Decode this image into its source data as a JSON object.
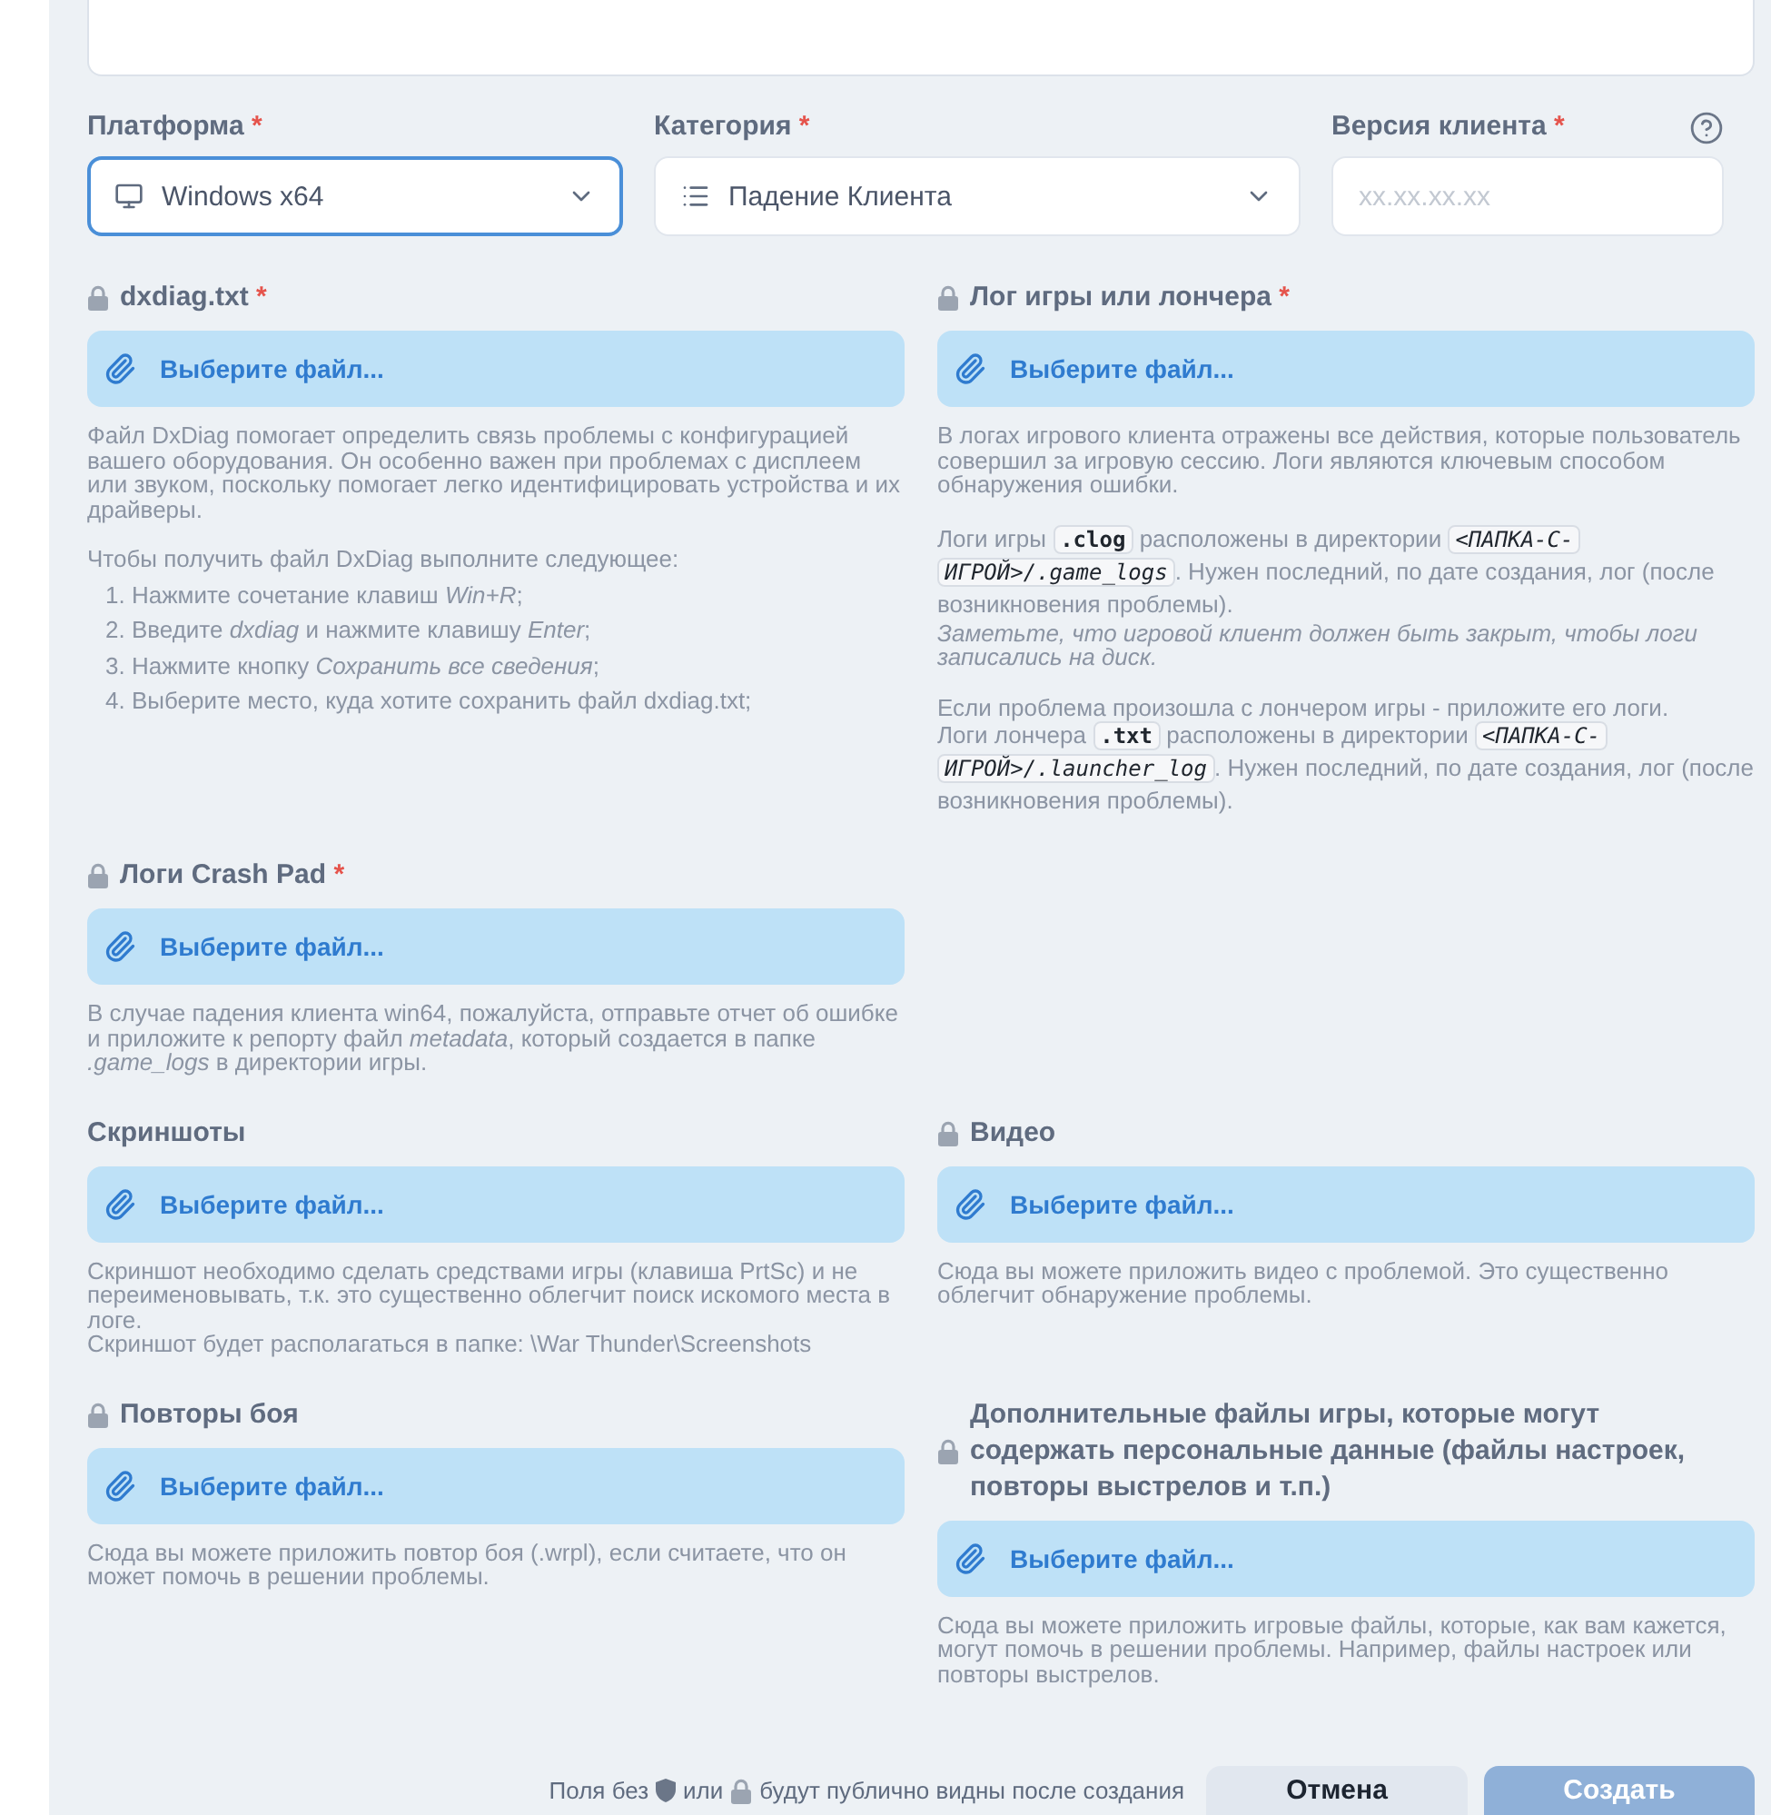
{
  "fields": [
    {
      "kind": "platform",
      "label": "Платформа",
      "required_mark": "*",
      "value": "Windows x64",
      "focused": true,
      "help": false
    },
    {
      "kind": "category",
      "label": "Категория",
      "required_mark": "*",
      "value": "Падение Клиента",
      "focused": false,
      "help": false
    },
    {
      "kind": "version",
      "label": "Версия клиента",
      "required_mark": "*",
      "placeholder": "xx.xx.xx.xx",
      "focused": false,
      "help": true
    }
  ],
  "rows": [
    {
      "items": [
        {
          "label": "dxdiag.txt",
          "required_mark": "*",
          "locked": true,
          "button": "Выберите файл...",
          "blocks": [
            {
              "paragraphs": [
                {
                  "kind": "text",
                  "text": "Файл DxDiag помогает определить связь проблемы с конфигурацией вашего оборудования. Он особенно важен при проблемах с дисплеем или звуком, поскольку помогает легко идентифицировать устройства и их драйверы."
                }
              ]
            },
            {
              "paragraphs": [
                {
                  "kind": "text",
                  "text": "Чтобы получить файл DxDiag выполните следующее:"
                },
                {
                  "kind": "step",
                  "text": "1. Нажмите сочетание клавиш *Win+R*;"
                },
                {
                  "kind": "step",
                  "text": "2. Введите *dxdiag* и нажмите клавишу *Enter*;"
                },
                {
                  "kind": "step",
                  "text": "3. Нажмите кнопку *Сохранить все сведения*;"
                },
                {
                  "kind": "step",
                  "text": "4. Выберите место, куда хотите сохранить файл dxdiag.txt;"
                }
              ]
            }
          ]
        },
        {
          "label": "Лог игры или лончера",
          "required_mark": "*",
          "locked": true,
          "button": "Выберите файл...",
          "blocks": [
            {
              "paragraphs": [
                {
                  "kind": "text",
                  "text": "В логах игрового клиента отражены все действия, которые пользователь совершил за игровую сессию. Логи являются ключевым способом обнаружения ошибки."
                }
              ]
            },
            {
              "paragraphs": [
                {
                  "kind": "mixed",
                  "parts": [
                    {
                      "kind": "text",
                      "text": "Логи игры "
                    },
                    {
                      "kind": "code",
                      "text": ".clog"
                    },
                    {
                      "kind": "text",
                      "text": " расположены в директории "
                    },
                    {
                      "kind": "path",
                      "text": "<ПАПКА-С-ИГРОЙ>/.game_logs"
                    },
                    {
                      "kind": "text",
                      "text": ". Нужен последний, по дате создания, лог (после возникновения проблемы)."
                    }
                  ]
                },
                {
                  "kind": "note",
                  "text": "Заметьте, что игровой клиент должен быть закрыт, чтобы логи записались на диск."
                }
              ]
            },
            {
              "paragraphs": [
                {
                  "kind": "text",
                  "text": "Если проблема произошла с лончером игры - приложите его логи."
                },
                {
                  "kind": "mixed",
                  "parts": [
                    {
                      "kind": "text",
                      "text": "Логи лончера "
                    },
                    {
                      "kind": "code",
                      "text": ".txt"
                    },
                    {
                      "kind": "text",
                      "text": " расположены в директории "
                    },
                    {
                      "kind": "path",
                      "text": "<ПАПКА-С-ИГРОЙ>/.launcher_log"
                    },
                    {
                      "kind": "text",
                      "text": ". Нужен последний, по дате создания, лог (после возникновения проблемы)."
                    }
                  ]
                }
              ]
            }
          ]
        }
      ]
    },
    {
      "items": [
        {
          "label": "Логи Crash Pad",
          "required_mark": "*",
          "locked": true,
          "button": "Выберите файл...",
          "blocks": [
            {
              "paragraphs": [
                {
                  "kind": "text",
                  "text": "В случае падения клиента win64, пожалуйста, отправьте отчет об ошибке и приложите к репорту файл *metadata*, который создается в папке *.game_logs* в директории игры."
                }
              ]
            }
          ]
        }
      ]
    },
    {
      "items": [
        {
          "label": "Скриншоты",
          "locked": false,
          "button": "Выберите файл...",
          "blocks": [
            {
              "paragraphs": [
                {
                  "kind": "text",
                  "text": "Скриншот необходимо сделать средствами игры (клавиша PrtSc) и не переименовывать, т.к. это существенно облегчит поиск искомого места в логе."
                },
                {
                  "kind": "text",
                  "text": "Скриншот будет располагаться в папке: \\War Thunder\\Screenshots"
                }
              ]
            }
          ]
        },
        {
          "label": "Видео",
          "locked": true,
          "button": "Выберите файл...",
          "blocks": [
            {
              "paragraphs": [
                {
                  "kind": "text",
                  "text": "Сюда вы можете приложить видео с проблемой. Это существенно облегчит обнаружение проблемы."
                }
              ]
            }
          ]
        }
      ]
    },
    {
      "items": [
        {
          "label": "Повторы боя",
          "locked": true,
          "button": "Выберите файл...",
          "blocks": [
            {
              "paragraphs": [
                {
                  "kind": "text",
                  "text": "Сюда вы можете приложить повтор боя (.wrpl), если считаете, что он может помочь в решении проблемы."
                }
              ]
            }
          ]
        },
        {
          "label": "Дополнительные файлы игры, которые могут содержать персональные данные (файлы настроек, повторы выстрелов и т.п.)",
          "locked": true,
          "button": "Выберите файл...",
          "blocks": [
            {
              "paragraphs": [
                {
                  "kind": "text",
                  "text": "Сюда вы можете приложить игровые файлы, которые, как вам кажется, могут помочь в решении проблемы. Например, файлы настроек или повторы выстрелов."
                }
              ]
            }
          ]
        }
      ]
    }
  ],
  "footer": {
    "note_before": "Поля без",
    "note_middle": "или",
    "note_after": "будут публично видны после создания",
    "cancel": "Отмена",
    "submit": {
      "label": "Создать",
      "disabled": true
    }
  }
}
